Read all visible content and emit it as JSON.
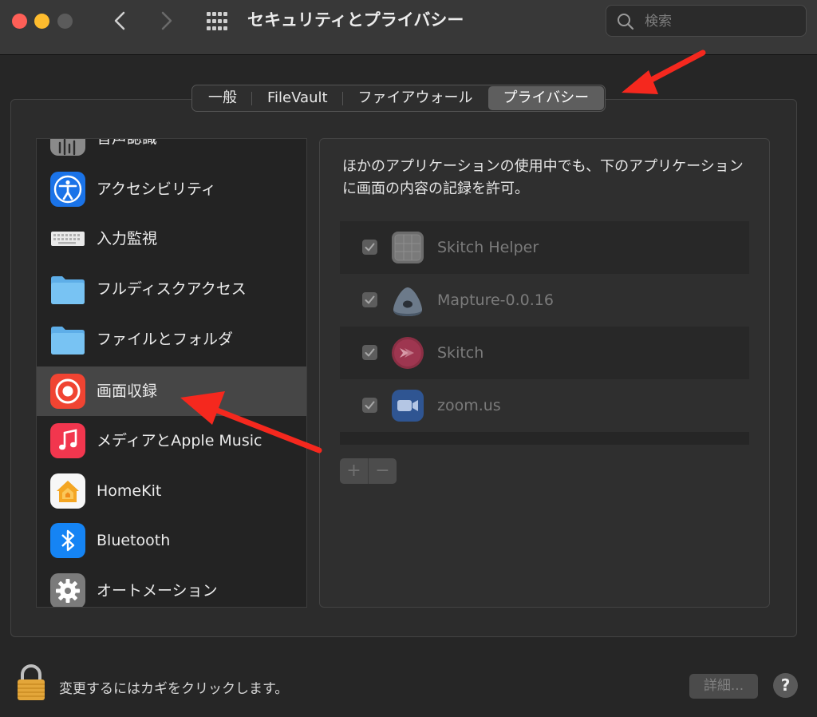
{
  "window": {
    "title": "セキュリティとプライバシー",
    "search_placeholder": "検索"
  },
  "tabs": [
    {
      "label": "一般",
      "active": false
    },
    {
      "label": "FileVault",
      "active": false
    },
    {
      "label": "ファイアウォール",
      "active": false
    },
    {
      "label": "プライバシー",
      "active": true
    }
  ],
  "sidebar": {
    "items": [
      {
        "label": "音声認識",
        "icon": "waveform-icon",
        "partially_hidden": true
      },
      {
        "label": "アクセシビリティ",
        "icon": "accessibility-icon"
      },
      {
        "label": "入力監視",
        "icon": "keyboard-icon"
      },
      {
        "label": "フルディスクアクセス",
        "icon": "folder-icon"
      },
      {
        "label": "ファイルとフォルダ",
        "icon": "folder-icon"
      },
      {
        "label": "画面収録",
        "icon": "screen-record-icon",
        "selected": true
      },
      {
        "label": "メディアとApple Music",
        "icon": "music-icon"
      },
      {
        "label": "HomeKit",
        "icon": "home-icon"
      },
      {
        "label": "Bluetooth",
        "icon": "bluetooth-icon"
      },
      {
        "label": "オートメーション",
        "icon": "gear-icon"
      }
    ]
  },
  "panel": {
    "description": "ほかのアプリケーションの使用中でも、下のアプリケーションに画面の内容の記録を許可。",
    "apps": [
      {
        "name": "Skitch Helper",
        "checked": true,
        "icon": "skitch-helper-icon"
      },
      {
        "name": "Mapture-0.0.16",
        "checked": true,
        "icon": "mapture-icon"
      },
      {
        "name": "Skitch",
        "checked": true,
        "icon": "skitch-icon"
      },
      {
        "name": "zoom.us",
        "checked": true,
        "icon": "zoom-icon"
      }
    ],
    "add_label": "+",
    "remove_label": "−"
  },
  "footer": {
    "lock_text": "変更するにはカギをクリックします。",
    "advanced_label": "詳細...",
    "help_label": "?"
  },
  "colors": {
    "selection": "#464646",
    "annotation_arrow": "#f5281e"
  }
}
